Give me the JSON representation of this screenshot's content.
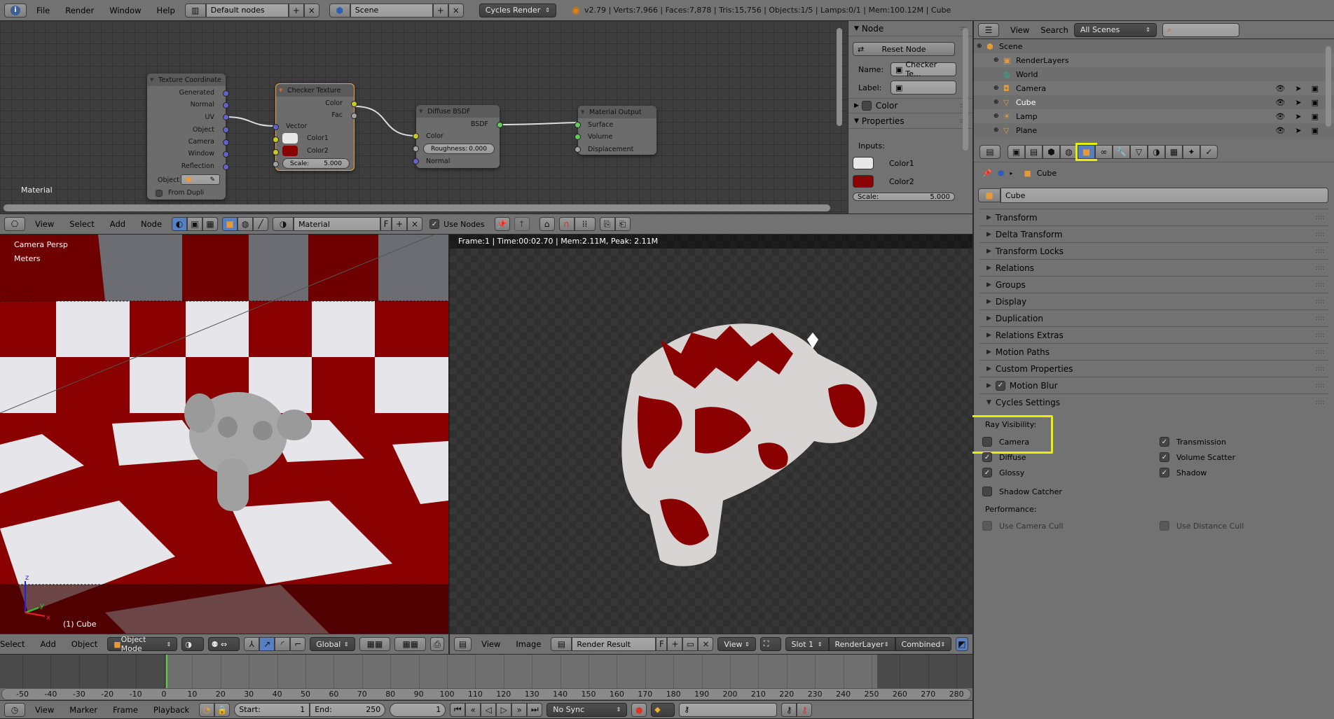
{
  "topbar": {
    "menus": [
      "File",
      "Render",
      "Window",
      "Help"
    ],
    "layout": "Default nodes",
    "scene": "Scene",
    "engine": "Cycles Render",
    "stats": "v2.79 | Verts:7,966 | Faces:7,878 | Tris:15,756 | Objects:1/5 | Lamps:0/1 | Mem:100.12M | Cube"
  },
  "node_editor": {
    "area_label": "Material",
    "nodes": {
      "texcoord": {
        "title": "Texture Coordinate",
        "outputs": [
          "Generated",
          "Normal",
          "UV",
          "Object",
          "Camera",
          "Window",
          "Reflection"
        ],
        "object_label": "Object",
        "from_dupli": "From Dupli"
      },
      "checker": {
        "title": "Checker Texture",
        "outputs": [
          "Color",
          "Fac"
        ],
        "inputs": [
          "Vector",
          "Color1",
          "Color2"
        ],
        "scale_label": "Scale:",
        "scale_value": "5.000",
        "color1": "#e8e8e8",
        "color2": "#8b0000"
      },
      "diffuse": {
        "title": "Diffuse BSDF",
        "output": "BSDF",
        "inputs": [
          "Color",
          "Normal"
        ],
        "roughness_label": "Roughness:",
        "roughness_value": "0.000"
      },
      "output": {
        "title": "Material Output",
        "inputs": [
          "Surface",
          "Volume",
          "Displacement"
        ]
      }
    },
    "header": {
      "menus": [
        "View",
        "Select",
        "Add",
        "Node"
      ],
      "material": "Material",
      "fake_user": "F",
      "use_nodes": "Use Nodes",
      "use_nodes_checked": true
    }
  },
  "npanel": {
    "node_section": "Node",
    "reset_node": "Reset Node",
    "name_label": "Name:",
    "name_value": "Checker Te...",
    "label_label": "Label:",
    "label_value": "",
    "color_section": "Color",
    "properties_section": "Properties",
    "inputs_label": "Inputs:",
    "color1": "Color1",
    "color2": "Color2",
    "scale_label": "Scale:",
    "scale_value": "5.000"
  },
  "outliner": {
    "menus": [
      "View",
      "Search"
    ],
    "filter": "All Scenes",
    "search_placeholder": "",
    "items": [
      {
        "name": "Scene",
        "indent": 0
      },
      {
        "name": "RenderLayers",
        "indent": 1
      },
      {
        "name": "World",
        "indent": 1
      },
      {
        "name": "Camera",
        "indent": 1,
        "restrict": true
      },
      {
        "name": "Cube",
        "indent": 1,
        "restrict": true,
        "selected": true
      },
      {
        "name": "Lamp",
        "indent": 1,
        "restrict": true
      },
      {
        "name": "Plane",
        "indent": 1,
        "restrict": true
      }
    ]
  },
  "properties": {
    "tabs": [
      "render",
      "render-layers",
      "scene",
      "world",
      "object",
      "constraints",
      "modifiers",
      "data",
      "material",
      "texture",
      "particles",
      "physics"
    ],
    "active_tab": "object",
    "breadcrumb": "Cube",
    "object_name": "Cube",
    "sections": [
      "Transform",
      "Delta Transform",
      "Transform Locks",
      "Relations",
      "Groups",
      "Display",
      "Duplication",
      "Relations Extras",
      "Motion Paths",
      "Custom Properties",
      "Motion Blur",
      "Cycles Settings"
    ],
    "motion_blur_checked": true,
    "cycles": {
      "ray_visibility_label": "Ray Visibility:",
      "left": [
        {
          "label": "Camera",
          "checked": false
        },
        {
          "label": "Diffuse",
          "checked": true
        },
        {
          "label": "Glossy",
          "checked": true
        }
      ],
      "right": [
        {
          "label": "Transmission",
          "checked": true
        },
        {
          "label": "Volume Scatter",
          "checked": true
        },
        {
          "label": "Shadow",
          "checked": true
        }
      ],
      "shadow_catcher": {
        "label": "Shadow Catcher",
        "checked": false
      },
      "performance_label": "Performance:",
      "camera_cull": {
        "label": "Use Camera Cull",
        "checked": false
      },
      "distance_cull": {
        "label": "Use Distance Cull",
        "checked": false
      }
    },
    "highlight_color": "#e6f000"
  },
  "viewport": {
    "view_name": "Camera Persp",
    "units": "Meters",
    "object_info": "(1) Cube",
    "header": {
      "menus": [
        "Select",
        "Add",
        "Object"
      ],
      "mode": "Object Mode",
      "orientation": "Global"
    }
  },
  "image_editor": {
    "render_info": "Frame:1 | Time:00:02.70 | Mem:2.11M, Peak: 2.11M",
    "header": {
      "menus": [
        "View",
        "Image"
      ],
      "image": "Render Result",
      "fake_user": "F",
      "view": "View",
      "slot": "Slot 1",
      "layer": "RenderLayer",
      "pass": "Combined"
    }
  },
  "timeline": {
    "ticks": [
      "-50",
      "-40",
      "-30",
      "-20",
      "-10",
      "0",
      "10",
      "20",
      "30",
      "40",
      "50",
      "60",
      "70",
      "80",
      "90",
      "100",
      "110",
      "120",
      "130",
      "140",
      "150",
      "160",
      "170",
      "180",
      "190",
      "200",
      "210",
      "220",
      "230",
      "240",
      "250",
      "260",
      "270",
      "280"
    ],
    "current_frame": 1,
    "header": {
      "menus": [
        "View",
        "Marker",
        "Frame",
        "Playback"
      ],
      "start_label": "Start:",
      "start": "1",
      "end_label": "End:",
      "end": "250",
      "current": "1",
      "sync": "No Sync"
    }
  }
}
